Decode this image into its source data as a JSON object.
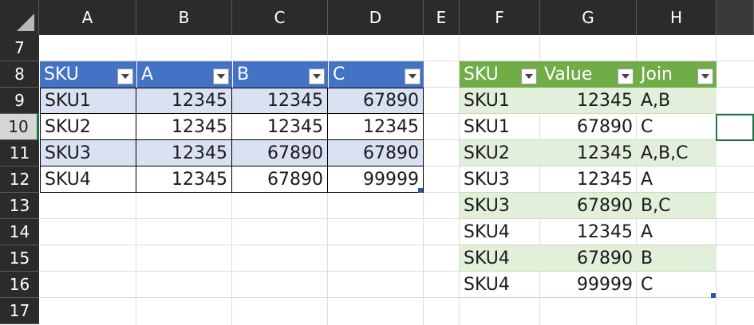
{
  "columns": [
    "A",
    "B",
    "C",
    "D",
    "E",
    "F",
    "G",
    "H"
  ],
  "rows": [
    "7",
    "8",
    "9",
    "10",
    "11",
    "12",
    "13",
    "14",
    "15",
    "16",
    "17"
  ],
  "active_row": "10",
  "colors": {
    "table1_header": "#4472c4",
    "table1_band": "#d9e1f2",
    "table2_header": "#70ad47",
    "table2_band": "#e2efda",
    "selection": "#217346"
  },
  "icons": {
    "filter": "filter-dropdown-icon",
    "select_all": "select-all-triangle-icon"
  },
  "table1": {
    "headers": [
      "SKU",
      "A",
      "B",
      "C"
    ],
    "rows": [
      [
        "SKU1",
        "12345",
        "12345",
        "67890"
      ],
      [
        "SKU2",
        "12345",
        "12345",
        "12345"
      ],
      [
        "SKU3",
        "12345",
        "67890",
        "67890"
      ],
      [
        "SKU4",
        "12345",
        "67890",
        "99999"
      ]
    ]
  },
  "table2": {
    "headers": [
      "SKU",
      "Value",
      "Join"
    ],
    "rows": [
      [
        "SKU1",
        "12345",
        "A,B"
      ],
      [
        "SKU1",
        "67890",
        "C"
      ],
      [
        "SKU2",
        "12345",
        "A,B,C"
      ],
      [
        "SKU3",
        "12345",
        "A"
      ],
      [
        "SKU3",
        "67890",
        "B,C"
      ],
      [
        "SKU4",
        "12345",
        "A"
      ],
      [
        "SKU4",
        "67890",
        "B"
      ],
      [
        "SKU4",
        "99999",
        "C"
      ]
    ]
  }
}
